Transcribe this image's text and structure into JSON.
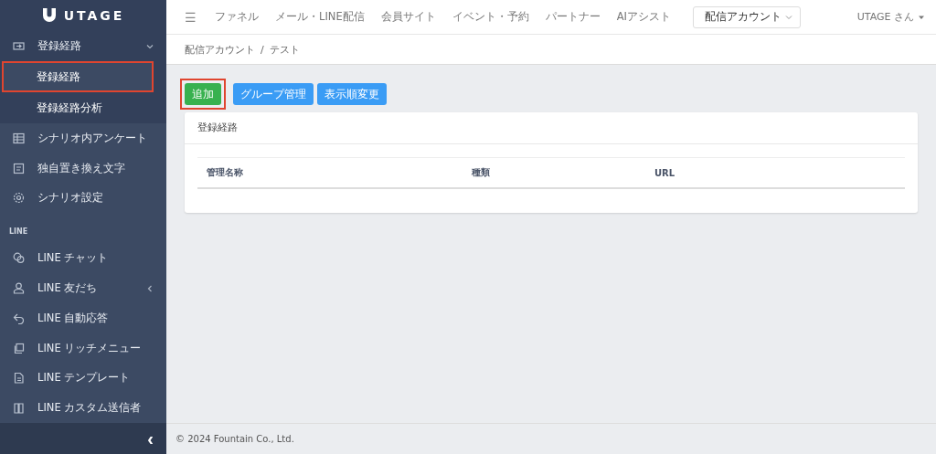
{
  "sidebar": {
    "logo": "UTAGE",
    "items": [
      {
        "kind": "group",
        "label": "登録経路",
        "expanded": true,
        "children": [
          {
            "label": "登録経路",
            "selected": true,
            "annotated": true
          },
          {
            "label": "登録経路分析",
            "selected": false,
            "annotated": false
          }
        ]
      },
      {
        "kind": "item",
        "label": "シナリオ内アンケート"
      },
      {
        "kind": "item",
        "label": "独自置き換え文字"
      },
      {
        "kind": "item",
        "label": "シナリオ設定"
      },
      {
        "kind": "header",
        "label": "LINE"
      },
      {
        "kind": "item",
        "label": "LINE チャット"
      },
      {
        "kind": "group",
        "label": "LINE 友だち",
        "expanded": false
      },
      {
        "kind": "item",
        "label": "LINE 自動応答"
      },
      {
        "kind": "item",
        "label": "LINE リッチメニュー"
      },
      {
        "kind": "item",
        "label": "LINE テンプレート"
      },
      {
        "kind": "item",
        "label": "LINE カスタム送信者"
      }
    ],
    "collapse_button": "‹"
  },
  "topnav": {
    "menu_icon": "☰",
    "links": [
      "ファネル",
      "メール・LINE配信",
      "会員サイト",
      "イベント・予約",
      "パートナー",
      "AIアシスト"
    ],
    "account_select": "配信アカウント",
    "user": "UTAGE さん"
  },
  "breadcrumb": {
    "items": [
      "配信アカウント",
      "テスト"
    ],
    "separator": "/"
  },
  "buttons": [
    {
      "label": "追加",
      "kind": "success",
      "annotated": true
    },
    {
      "label": "グループ管理",
      "kind": "primary",
      "annotated": false
    },
    {
      "label": "表示順変更",
      "kind": "primary",
      "annotated": false
    }
  ],
  "card": {
    "title": "登録経路",
    "columns": [
      "管理名称",
      "種類",
      "URL"
    ]
  },
  "footer": "© 2024 Fountain Co., Ltd."
}
